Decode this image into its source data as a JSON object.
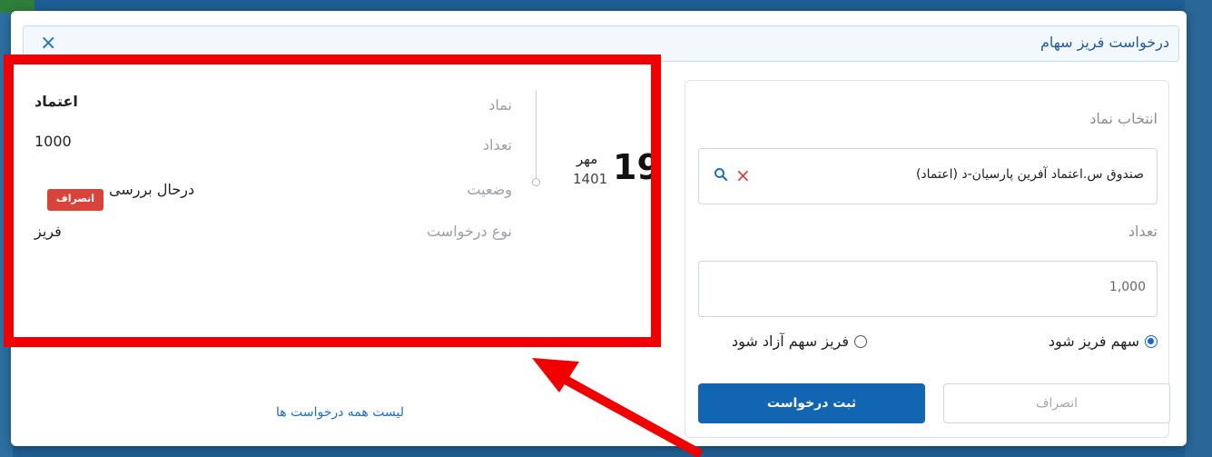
{
  "modal": {
    "title": "درخواست فریز سهام",
    "close_icon": "×"
  },
  "form": {
    "symbol_label": "انتخاب نماد",
    "symbol_value": "صندوق س.اعتماد آفرین پارسیان-د (اعتماد)",
    "quantity_label": "تعداد",
    "quantity_value": "1,000",
    "radio_freeze": "سهم فریز شود",
    "radio_unfreeze": "فریز سهم آزاد شود",
    "radio_selected": "freeze",
    "cancel_label": "انصراف",
    "submit_label": "ثبت درخواست"
  },
  "history": {
    "date_day": "19",
    "date_month": "مهر",
    "date_year": "1401",
    "symbol_key": "نماد",
    "symbol_val": "اعتماد",
    "count_key": "تعداد",
    "count_val": "1000",
    "status_key": "وضعیت",
    "status_val": "درحال بررسی",
    "cancel_badge": "انصراف",
    "type_key": "نوع درخواست",
    "type_val": "فریز",
    "all_requests_link": "لیست همه درخواست ها"
  },
  "colors": {
    "primary": "#1265b0",
    "danger": "#d9443a",
    "highlight": "#f00000"
  }
}
